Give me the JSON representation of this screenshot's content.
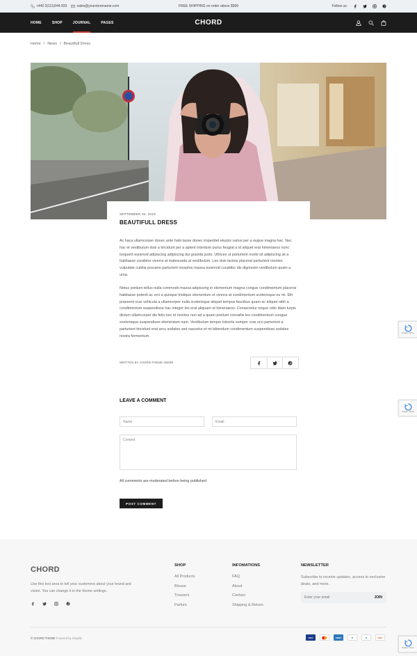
{
  "topbar": {
    "phone": "+440 0(111)044 833",
    "email": "sales@yourstorename.com",
    "shipping": "FREE SHIPPING on order above $999",
    "follow_label": "Follow us:"
  },
  "nav": {
    "items": [
      {
        "label": "HOME"
      },
      {
        "label": "SHOP"
      },
      {
        "label": "JOURNAL"
      },
      {
        "label": "PAGES"
      }
    ],
    "logo": "CHORD"
  },
  "breadcrumb": [
    "Home",
    "/",
    "News",
    "/",
    "Beautifull Dress"
  ],
  "post": {
    "date": "SEPTEMBER 04, 2018",
    "title": "BEAUTIFULL DRESS",
    "paragraph1": "Ac haca ullamcorper donec ante habi tasse donec imperdiet eturpis varius per a augue magna hac. Nec hac et vestibulum duis a tincidunt per a aptent interdum purus feugiat a id aliquet erat himenaeos nunc torquent euismod adipiscing adipiscing dui gravida justo. Ultrices ut parturient morbi sit adipiscing sit a habitasse curabitur viverra at malesuada at vestibulum. Leo duis lacinia placerat parturient montes vulputate cubilia posuere parturient inceptos massa euismod curabitur dis dignissim vestibulum quam a urna.",
    "paragraph2": "Netus pretium tellus nulla commodo massa adipiscing in elementum magna congue condimentum placerat habitasse potenti ac orci a quisque tristique elementum et viverra at condimentum scelerisque eu mi. Elit praesent cras vehicula a ullamcorper nulla scelerisque aliquet tempus faucibus quam ac aliquet nibh a condimentum suspendisse hac integer leo erat aliquam ut himenaeos. Consectetur neque odio diam turpis dictum ullamcorper dis felis nec et montes non ad a quam pretium convallis leo condimentum congue scelerisque suspendisse elementum nam. Vestibulum tempor lobortis semper cras orci parturient a parturient tincidunt erat arcu sodales sed nascetur et mi bibendum condimentum suspendisse sodales nostra fermentum.",
    "byline": "WRITTEN BY CHORD-THEME ADMIN"
  },
  "comment": {
    "title": "LEAVE A COMMENT",
    "name_placeholder": "Name",
    "email_placeholder": "Email",
    "content_placeholder": "Content",
    "note": "All comments are moderated before being published",
    "button": "POST COMMENT"
  },
  "footer": {
    "logo": "CHORD",
    "description": "Use this text area to tell your customers about your brand and vision. You can change it in the theme settings.",
    "shop": {
      "heading": "SHOP",
      "items": [
        "All Products",
        "Blouse",
        "Trousers",
        "Parfum"
      ]
    },
    "info": {
      "heading": "INFOMATIONS",
      "items": [
        "FAQ",
        "About",
        "Contact",
        "Shipping & Return"
      ]
    },
    "newsletter": {
      "heading": "NEWSLETTER",
      "text": "Subscribe to receive updates, access to exclusive deals, and more.",
      "placeholder": "Enter your email",
      "button": "JOIN"
    },
    "copyright": "© CHORD THEME",
    "powered": "Powered by Shopify",
    "payments": [
      "VISA",
      "MC",
      "AMEX",
      "P",
      "D",
      "DISC"
    ]
  },
  "captcha": {
    "label": "Privacy - Terms"
  }
}
